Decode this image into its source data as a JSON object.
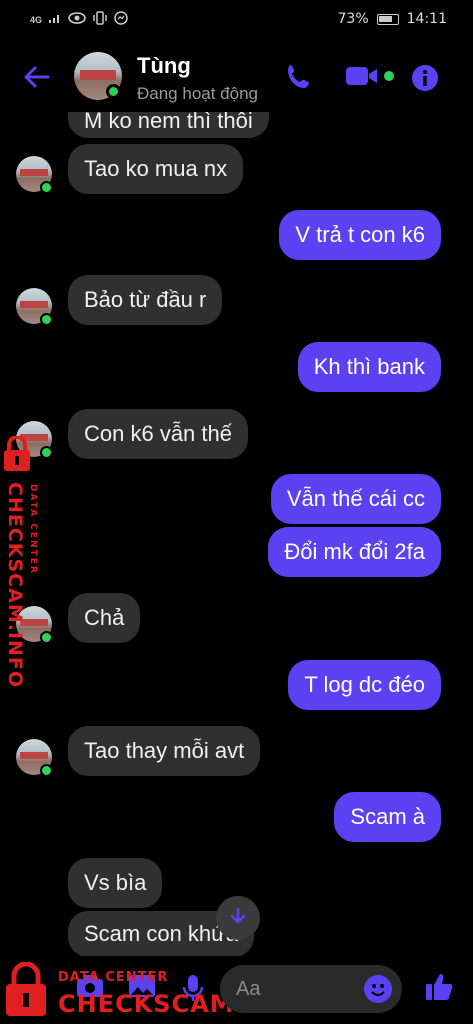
{
  "status_bar": {
    "network": "4G",
    "battery_percent": "73%",
    "time": "14:11"
  },
  "header": {
    "contact_name": "Tùng",
    "contact_status": "Đang hoạt động"
  },
  "messages": [
    {
      "direction": "in",
      "text": "M ko nem thì thôi"
    },
    {
      "direction": "in",
      "text": "Tao ko mua nx"
    },
    {
      "direction": "out",
      "text": "V trả t con k6"
    },
    {
      "direction": "in",
      "text": "Bảo từ đầu r"
    },
    {
      "direction": "out",
      "text": "Kh thì bank"
    },
    {
      "direction": "in",
      "text": "Con k6 vẫn thế"
    },
    {
      "direction": "out",
      "text": "Vẫn thế cái cc"
    },
    {
      "direction": "out",
      "text": "Đổi mk đổi 2fa"
    },
    {
      "direction": "in",
      "text": "Chả"
    },
    {
      "direction": "out",
      "text": "T log dc đéo"
    },
    {
      "direction": "in",
      "text": "Tao thay mỗi avt"
    },
    {
      "direction": "out",
      "text": "Scam à"
    },
    {
      "direction": "in",
      "text": "Vs bìa"
    },
    {
      "direction": "in",
      "text": "Scam con khứa"
    }
  ],
  "composer": {
    "placeholder": "Aa"
  },
  "watermark": {
    "brand": "CHECKSCAM.INFO",
    "subtitle": "DATA CENTER"
  },
  "colors": {
    "accent": "#5a41f2",
    "incoming_bubble": "#303030",
    "online": "#31d158",
    "watermark": "#e02020"
  }
}
